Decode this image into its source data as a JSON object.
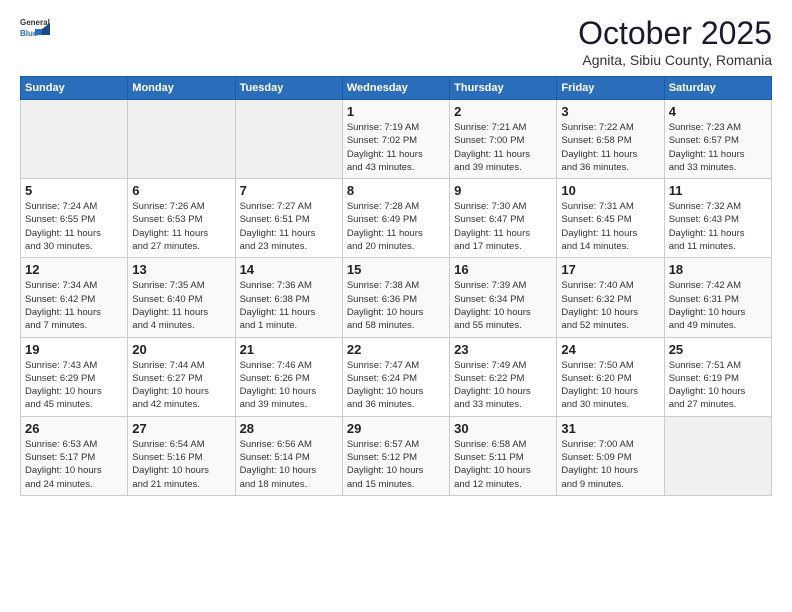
{
  "header": {
    "logo_general": "General",
    "logo_blue": "Blue",
    "month": "October 2025",
    "location": "Agnita, Sibiu County, Romania"
  },
  "weekdays": [
    "Sunday",
    "Monday",
    "Tuesday",
    "Wednesday",
    "Thursday",
    "Friday",
    "Saturday"
  ],
  "weeks": [
    [
      {
        "day": "",
        "content": ""
      },
      {
        "day": "",
        "content": ""
      },
      {
        "day": "",
        "content": ""
      },
      {
        "day": "1",
        "content": "Sunrise: 7:19 AM\nSunset: 7:02 PM\nDaylight: 11 hours\nand 43 minutes."
      },
      {
        "day": "2",
        "content": "Sunrise: 7:21 AM\nSunset: 7:00 PM\nDaylight: 11 hours\nand 39 minutes."
      },
      {
        "day": "3",
        "content": "Sunrise: 7:22 AM\nSunset: 6:58 PM\nDaylight: 11 hours\nand 36 minutes."
      },
      {
        "day": "4",
        "content": "Sunrise: 7:23 AM\nSunset: 6:57 PM\nDaylight: 11 hours\nand 33 minutes."
      }
    ],
    [
      {
        "day": "5",
        "content": "Sunrise: 7:24 AM\nSunset: 6:55 PM\nDaylight: 11 hours\nand 30 minutes."
      },
      {
        "day": "6",
        "content": "Sunrise: 7:26 AM\nSunset: 6:53 PM\nDaylight: 11 hours\nand 27 minutes."
      },
      {
        "day": "7",
        "content": "Sunrise: 7:27 AM\nSunset: 6:51 PM\nDaylight: 11 hours\nand 23 minutes."
      },
      {
        "day": "8",
        "content": "Sunrise: 7:28 AM\nSunset: 6:49 PM\nDaylight: 11 hours\nand 20 minutes."
      },
      {
        "day": "9",
        "content": "Sunrise: 7:30 AM\nSunset: 6:47 PM\nDaylight: 11 hours\nand 17 minutes."
      },
      {
        "day": "10",
        "content": "Sunrise: 7:31 AM\nSunset: 6:45 PM\nDaylight: 11 hours\nand 14 minutes."
      },
      {
        "day": "11",
        "content": "Sunrise: 7:32 AM\nSunset: 6:43 PM\nDaylight: 11 hours\nand 11 minutes."
      }
    ],
    [
      {
        "day": "12",
        "content": "Sunrise: 7:34 AM\nSunset: 6:42 PM\nDaylight: 11 hours\nand 7 minutes."
      },
      {
        "day": "13",
        "content": "Sunrise: 7:35 AM\nSunset: 6:40 PM\nDaylight: 11 hours\nand 4 minutes."
      },
      {
        "day": "14",
        "content": "Sunrise: 7:36 AM\nSunset: 6:38 PM\nDaylight: 11 hours\nand 1 minute."
      },
      {
        "day": "15",
        "content": "Sunrise: 7:38 AM\nSunset: 6:36 PM\nDaylight: 10 hours\nand 58 minutes."
      },
      {
        "day": "16",
        "content": "Sunrise: 7:39 AM\nSunset: 6:34 PM\nDaylight: 10 hours\nand 55 minutes."
      },
      {
        "day": "17",
        "content": "Sunrise: 7:40 AM\nSunset: 6:32 PM\nDaylight: 10 hours\nand 52 minutes."
      },
      {
        "day": "18",
        "content": "Sunrise: 7:42 AM\nSunset: 6:31 PM\nDaylight: 10 hours\nand 49 minutes."
      }
    ],
    [
      {
        "day": "19",
        "content": "Sunrise: 7:43 AM\nSunset: 6:29 PM\nDaylight: 10 hours\nand 45 minutes."
      },
      {
        "day": "20",
        "content": "Sunrise: 7:44 AM\nSunset: 6:27 PM\nDaylight: 10 hours\nand 42 minutes."
      },
      {
        "day": "21",
        "content": "Sunrise: 7:46 AM\nSunset: 6:26 PM\nDaylight: 10 hours\nand 39 minutes."
      },
      {
        "day": "22",
        "content": "Sunrise: 7:47 AM\nSunset: 6:24 PM\nDaylight: 10 hours\nand 36 minutes."
      },
      {
        "day": "23",
        "content": "Sunrise: 7:49 AM\nSunset: 6:22 PM\nDaylight: 10 hours\nand 33 minutes."
      },
      {
        "day": "24",
        "content": "Sunrise: 7:50 AM\nSunset: 6:20 PM\nDaylight: 10 hours\nand 30 minutes."
      },
      {
        "day": "25",
        "content": "Sunrise: 7:51 AM\nSunset: 6:19 PM\nDaylight: 10 hours\nand 27 minutes."
      }
    ],
    [
      {
        "day": "26",
        "content": "Sunrise: 6:53 AM\nSunset: 5:17 PM\nDaylight: 10 hours\nand 24 minutes."
      },
      {
        "day": "27",
        "content": "Sunrise: 6:54 AM\nSunset: 5:16 PM\nDaylight: 10 hours\nand 21 minutes."
      },
      {
        "day": "28",
        "content": "Sunrise: 6:56 AM\nSunset: 5:14 PM\nDaylight: 10 hours\nand 18 minutes."
      },
      {
        "day": "29",
        "content": "Sunrise: 6:57 AM\nSunset: 5:12 PM\nDaylight: 10 hours\nand 15 minutes."
      },
      {
        "day": "30",
        "content": "Sunrise: 6:58 AM\nSunset: 5:11 PM\nDaylight: 10 hours\nand 12 minutes."
      },
      {
        "day": "31",
        "content": "Sunrise: 7:00 AM\nSunset: 5:09 PM\nDaylight: 10 hours\nand 9 minutes."
      },
      {
        "day": "",
        "content": ""
      }
    ]
  ]
}
